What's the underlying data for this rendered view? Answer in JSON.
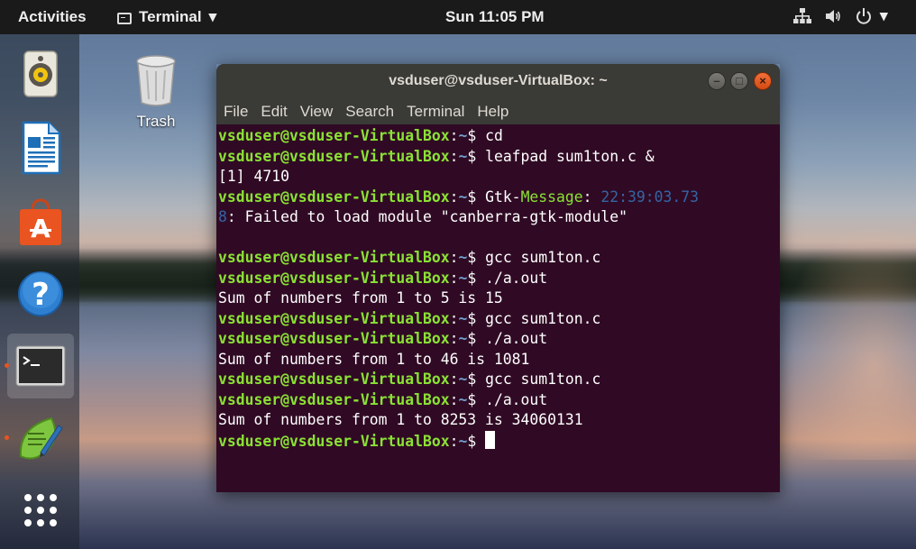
{
  "topbar": {
    "activities": "Activities",
    "app_name": "Terminal",
    "app_arrow": "▾",
    "clock": "Sun 11:05 PM",
    "tray_arrow": "▾"
  },
  "dock": {
    "items": [
      {
        "name": "rhythmbox",
        "icon": "speaker-icon"
      },
      {
        "name": "libreoffice-writer",
        "icon": "document-icon"
      },
      {
        "name": "ubuntu-software",
        "icon": "shopping-bag-icon",
        "glyph": "A"
      },
      {
        "name": "help",
        "icon": "help-icon",
        "glyph": "?"
      },
      {
        "name": "terminal",
        "icon": "terminal-icon",
        "glyph": ">_",
        "active": true
      },
      {
        "name": "leafpad",
        "icon": "notepad-icon"
      },
      {
        "name": "show-applications",
        "icon": "grid-icon"
      }
    ]
  },
  "desktop": {
    "trash_label": "Trash"
  },
  "terminal": {
    "title": "vsduser@vsduser-VirtualBox: ~",
    "buttons": {
      "minimize": "–",
      "maximize": "□",
      "close": "×"
    },
    "menu": [
      "File",
      "Edit",
      "View",
      "Search",
      "Terminal",
      "Help"
    ],
    "prompt_user": "vsduser@vsduser-VirtualBox",
    "prompt_sep": ":",
    "prompt_path": "~",
    "prompt_end": "$ ",
    "lines": [
      {
        "type": "prompt",
        "cmd": "cd"
      },
      {
        "type": "prompt",
        "cmd": "leafpad sum1ton.c &"
      },
      {
        "type": "output",
        "text": "[1] 4710"
      },
      {
        "type": "prompt_msg",
        "cmd": "Gtk-",
        "key": "Message",
        "colon": ": ",
        "time": "22:39:03.73"
      },
      {
        "type": "output_time",
        "time": "8",
        "text": ": Failed to load module \"canberra-gtk-module\""
      },
      {
        "type": "output",
        "text": ""
      },
      {
        "type": "prompt",
        "cmd": "gcc sum1ton.c"
      },
      {
        "type": "prompt",
        "cmd": "./a.out"
      },
      {
        "type": "output",
        "text": "Sum of numbers from 1 to 5 is 15"
      },
      {
        "type": "prompt",
        "cmd": "gcc sum1ton.c"
      },
      {
        "type": "prompt",
        "cmd": "./a.out"
      },
      {
        "type": "output",
        "text": "Sum of numbers from 1 to 46 is 1081"
      },
      {
        "type": "prompt",
        "cmd": "gcc sum1ton.c"
      },
      {
        "type": "prompt",
        "cmd": "./a.out"
      },
      {
        "type": "output",
        "text": "Sum of numbers from 1 to 8253 is 34060131"
      },
      {
        "type": "prompt_cursor",
        "cmd": ""
      }
    ]
  },
  "colors": {
    "terminal_bg": "#300a24",
    "prompt_user": "#8ae234",
    "prompt_path": "#729fcf",
    "topbar_bg": "#1a1a1a",
    "accent": "#e95420"
  }
}
